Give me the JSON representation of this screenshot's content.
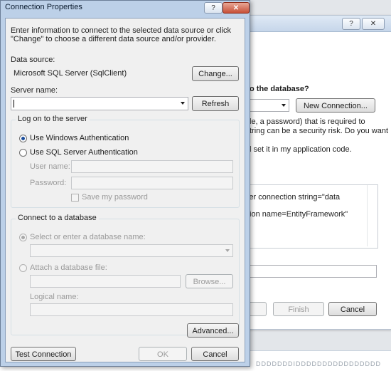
{
  "background_window": {
    "help_glyph": "?",
    "close_glyph": "✕",
    "question": "o the database?",
    "new_connection_label": "New Connection...",
    "desc_line1": "le, a password) that is required to",
    "desc_line2": "tring can be a security risk. Do you want",
    "option_text": "l set it in my application code.",
    "conn_line1": "ler connection string=\"data",
    "conn_line2": "tion name=EntityFramework\"",
    "finish_label": "Finish",
    "cancel_label": "Cancel",
    "bottom_text": "DDDDDDDIDDDDDDDDDDDDDDDD"
  },
  "dialog": {
    "title": "Connection Properties",
    "help_glyph": "?",
    "close_glyph": "✕",
    "intro": "Enter information to connect to the selected data source or click \"Change\" to choose a different data source and/or provider.",
    "data_source_label": "Data source:",
    "data_source_value": "Microsoft SQL Server (SqlClient)",
    "change_label": "Change...",
    "server_name_label": "Server name:",
    "server_name_value": "",
    "refresh_label": "Refresh",
    "logon": {
      "title": "Log on to the server",
      "windows_auth": "Use Windows Authentication",
      "sql_auth": "Use SQL Server Authentication",
      "user_name_label": "User name:",
      "password_label": "Password:",
      "save_password": "Save my password"
    },
    "connect_db": {
      "title": "Connect to a database",
      "select_db": "Select or enter a database name:",
      "attach_file": "Attach a database file:",
      "browse_label": "Browse...",
      "logical_name_label": "Logical name:"
    },
    "advanced_label": "Advanced...",
    "test_connection_label": "Test Connection",
    "ok_label": "OK",
    "cancel_label": "Cancel"
  }
}
